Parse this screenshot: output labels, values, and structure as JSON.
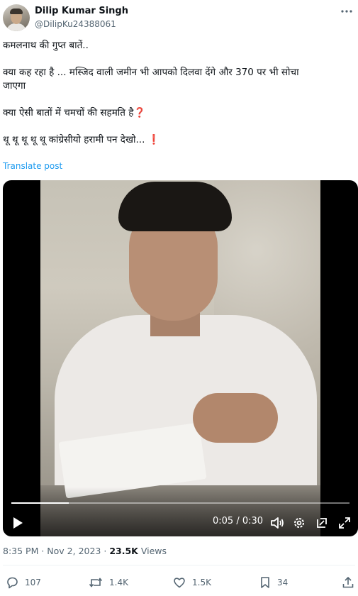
{
  "author": {
    "name": "Dilip Kumar Singh",
    "handle": "@DilipKu24388061"
  },
  "post": {
    "line1": "कमलनाथ की गुप्त बातें..",
    "line2": "क्या कह रहा है ... मस्जिद वाली जमीन भी आपको दिलवा देंगे और 370 पर भी सोचा",
    "line3": "जाएगा",
    "line4": "क्या ऐसी बातों में चमचों की सहमति है",
    "line4_mark": "❓",
    "line5": "थू थू थू थू थू कांग्रेसीयो हरामी पन देखो...",
    "line5_mark": "❗",
    "translate_label": "Translate post"
  },
  "video": {
    "current_time": "0:05",
    "separator": " / ",
    "duration": "0:30",
    "progress_fraction": 0.17
  },
  "meta": {
    "time": "8:35 PM",
    "dot1": " · ",
    "date": "Nov 2, 2023",
    "dot2": " · ",
    "views_count": "23.5K",
    "views_label": " Views"
  },
  "actions": {
    "replies": "107",
    "reposts": "1.4K",
    "likes": "1.5K",
    "bookmarks": "34"
  },
  "icons": {
    "more": "more-icon",
    "play": "play-icon",
    "volume": "volume-icon",
    "settings": "settings-icon",
    "pip": "pip-icon",
    "fullscreen": "fullscreen-icon",
    "reply": "reply-icon",
    "repost": "repost-icon",
    "like": "heart-icon",
    "bookmark": "bookmark-icon",
    "share": "share-icon"
  },
  "colors": {
    "link": "#1d9bf0",
    "muted": "#536471",
    "text": "#0f1419",
    "mark": "#d0021b"
  }
}
